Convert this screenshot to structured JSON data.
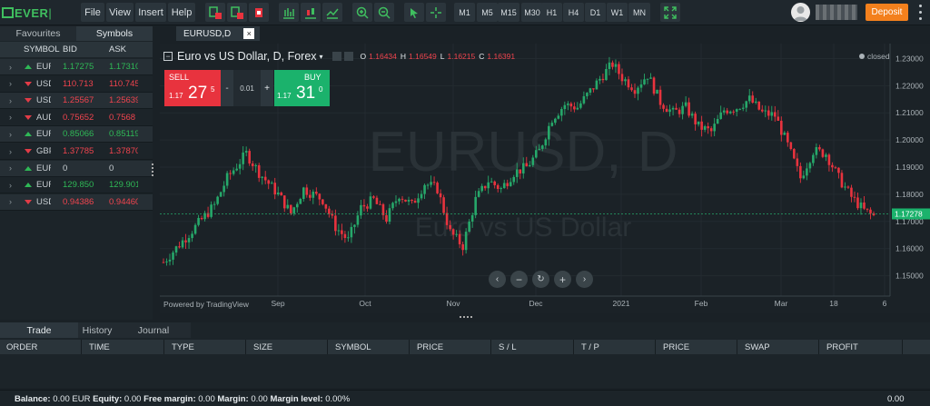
{
  "app": {
    "logo_a": "EVER",
    "logo_b": "|"
  },
  "toolbar": {
    "menus": [
      "File",
      "View",
      "Insert",
      "Help"
    ],
    "timeframes": [
      "M1",
      "M5",
      "M15",
      "M30",
      "H1",
      "H4",
      "D1",
      "W1",
      "MN"
    ],
    "deposit": "Deposit",
    "colors": {
      "deposit": "#f3801d",
      "buy": "#1bb26c",
      "sell": "#e8333e"
    }
  },
  "left_panel": {
    "tabs": [
      "Favourites",
      "Symbols"
    ],
    "active_tab": "Symbols",
    "columns": [
      "SYMBOL",
      "BID",
      "ASK"
    ],
    "rows": [
      {
        "symbol": "EUR",
        "bid": "1.17275",
        "ask": "1.17310",
        "dir": "up",
        "color": "g"
      },
      {
        "symbol": "USD",
        "bid": "110.713",
        "ask": "110.745",
        "dir": "down",
        "color": "r"
      },
      {
        "symbol": "USD",
        "bid": "1.25567",
        "ask": "1.25639",
        "dir": "down",
        "color": "r"
      },
      {
        "symbol": "AUD",
        "bid": "0.75652",
        "ask": "0.7568",
        "dir": "down",
        "color": "r"
      },
      {
        "symbol": "EUR",
        "bid": "0.85066",
        "ask": "0.85119",
        "dir": "up",
        "color": "g"
      },
      {
        "symbol": "GBP",
        "bid": "1.37785",
        "ask": "1.37870",
        "dir": "down",
        "color": "r"
      },
      {
        "symbol": "EUR",
        "bid": "0",
        "ask": "0",
        "dir": "up",
        "color": "n"
      },
      {
        "symbol": "EUR",
        "bid": "129.850",
        "ask": "129.901",
        "dir": "up",
        "color": "g"
      },
      {
        "symbol": "USD",
        "bid": "0.94386",
        "ask": "0.94460",
        "dir": "down",
        "color": "r"
      }
    ]
  },
  "chart_tab": {
    "label": "EURUSD,D",
    "close": "×"
  },
  "chart": {
    "title": "Euro vs US Dollar, D, Forex",
    "ohlc": {
      "o_label": "O",
      "o": "1.16434",
      "h_label": "H",
      "h": "1.16549",
      "l_label": "L",
      "l": "1.16215",
      "c_label": "C",
      "c": "1.16391"
    },
    "status": "closed",
    "watermark_symbol": "EURUSD, D",
    "watermark_name": "Euro vs US Dollar",
    "sell": {
      "label": "SELL",
      "prefix": "1.17",
      "big": "27",
      "small": "5"
    },
    "buy": {
      "label": "BUY",
      "prefix": "1.17",
      "big": "31",
      "small": "0"
    },
    "lot": {
      "minus": "-",
      "value": "0.01",
      "plus": "+"
    },
    "current_price": "1.17278",
    "powered": "Powered by TradingView"
  },
  "chart_data": {
    "type": "candlestick",
    "x_ticks": [
      "Sep",
      "Oct",
      "Nov",
      "Dec",
      "2021",
      "Feb",
      "Mar",
      "18",
      "6"
    ],
    "y_ticks": [
      "1.23000",
      "1.22000",
      "1.21000",
      "1.20000",
      "1.19000",
      "1.18000",
      "1.17000",
      "1.16000",
      "1.15000"
    ],
    "ylim": [
      1.1425,
      1.2355
    ],
    "current_price": 1.17278,
    "close_path": [
      [
        0,
        1.155
      ],
      [
        10,
        1.168
      ],
      [
        16,
        1.176
      ],
      [
        20,
        1.186
      ],
      [
        26,
        1.195
      ],
      [
        30,
        1.188
      ],
      [
        36,
        1.18
      ],
      [
        40,
        1.173
      ],
      [
        44,
        1.182
      ],
      [
        50,
        1.178
      ],
      [
        54,
        1.168
      ],
      [
        58,
        1.163
      ],
      [
        62,
        1.175
      ],
      [
        66,
        1.178
      ],
      [
        70,
        1.171
      ],
      [
        74,
        1.18
      ],
      [
        78,
        1.176
      ],
      [
        82,
        1.184
      ],
      [
        86,
        1.182
      ],
      [
        90,
        1.166
      ],
      [
        94,
        1.161
      ],
      [
        98,
        1.178
      ],
      [
        102,
        1.185
      ],
      [
        106,
        1.182
      ],
      [
        110,
        1.188
      ],
      [
        114,
        1.19
      ],
      [
        118,
        1.196
      ],
      [
        122,
        1.208
      ],
      [
        126,
        1.213
      ],
      [
        130,
        1.212
      ],
      [
        134,
        1.218
      ],
      [
        138,
        1.224
      ],
      [
        141,
        1.228
      ],
      [
        144,
        1.223
      ],
      [
        148,
        1.219
      ],
      [
        152,
        1.224
      ],
      [
        156,
        1.214
      ],
      [
        160,
        1.21
      ],
      [
        164,
        1.212
      ],
      [
        168,
        1.205
      ],
      [
        172,
        1.203
      ],
      [
        176,
        1.211
      ],
      [
        180,
        1.212
      ],
      [
        184,
        1.215
      ],
      [
        188,
        1.21
      ],
      [
        192,
        1.209
      ],
      [
        196,
        1.198
      ],
      [
        200,
        1.186
      ],
      [
        204,
        1.196
      ],
      [
        208,
        1.195
      ],
      [
        212,
        1.186
      ],
      [
        216,
        1.179
      ],
      [
        220,
        1.174
      ],
      [
        223,
        1.172
      ]
    ]
  },
  "bottom": {
    "tabs": [
      "Trade",
      "History",
      "Journal"
    ],
    "active_tab": "Trade",
    "columns": [
      "ORDER",
      "TIME",
      "TYPE",
      "SIZE",
      "SYMBOL",
      "PRICE",
      "S / L",
      "T / P",
      "PRICE",
      "SWAP",
      "PROFIT"
    ]
  },
  "status": {
    "balance_label": "Balance:",
    "balance": "0.00 EUR",
    "equity_label": "Equity:",
    "equity": "0.00",
    "free_label": "Free margin:",
    "free": "0.00",
    "margin_label": "Margin:",
    "margin": "0.00",
    "level_label": "Margin level:",
    "level": "0.00%",
    "profit": "0.00"
  }
}
